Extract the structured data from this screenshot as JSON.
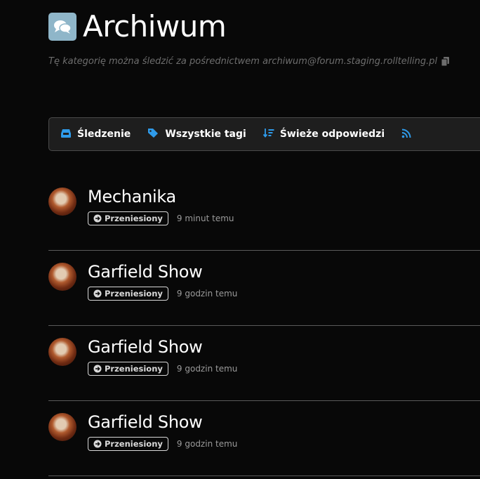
{
  "header": {
    "title": "Archiwum",
    "subtitle": "Tę kategorię można śledzić za pośrednictwem archiwum@forum.staging.rolltelling.pl"
  },
  "toolbar": {
    "items": [
      {
        "label": "Śledzenie",
        "icon": "inbox-icon"
      },
      {
        "label": "Wszystkie tagi",
        "icon": "tag-icon"
      },
      {
        "label": "Świeże odpowiedzi",
        "icon": "sort-amount-down-icon"
      },
      {
        "label": "",
        "icon": "rss-icon"
      }
    ]
  },
  "topics": [
    {
      "title": "Mechanika",
      "badge": "Przeniesiony",
      "time": "9 minut temu"
    },
    {
      "title": "Garfield Show",
      "badge": "Przeniesiony",
      "time": "9 godzin temu"
    },
    {
      "title": "Garfield Show",
      "badge": "Przeniesiony",
      "time": "9 godzin temu"
    },
    {
      "title": "Garfield Show",
      "badge": "Przeniesiony",
      "time": "9 godzin temu"
    }
  ],
  "colors": {
    "accent": "#2f9bea",
    "category_icon_bg": "#8fb6c9",
    "background": "#080808",
    "toolbar_bg": "#1e1e1e"
  }
}
